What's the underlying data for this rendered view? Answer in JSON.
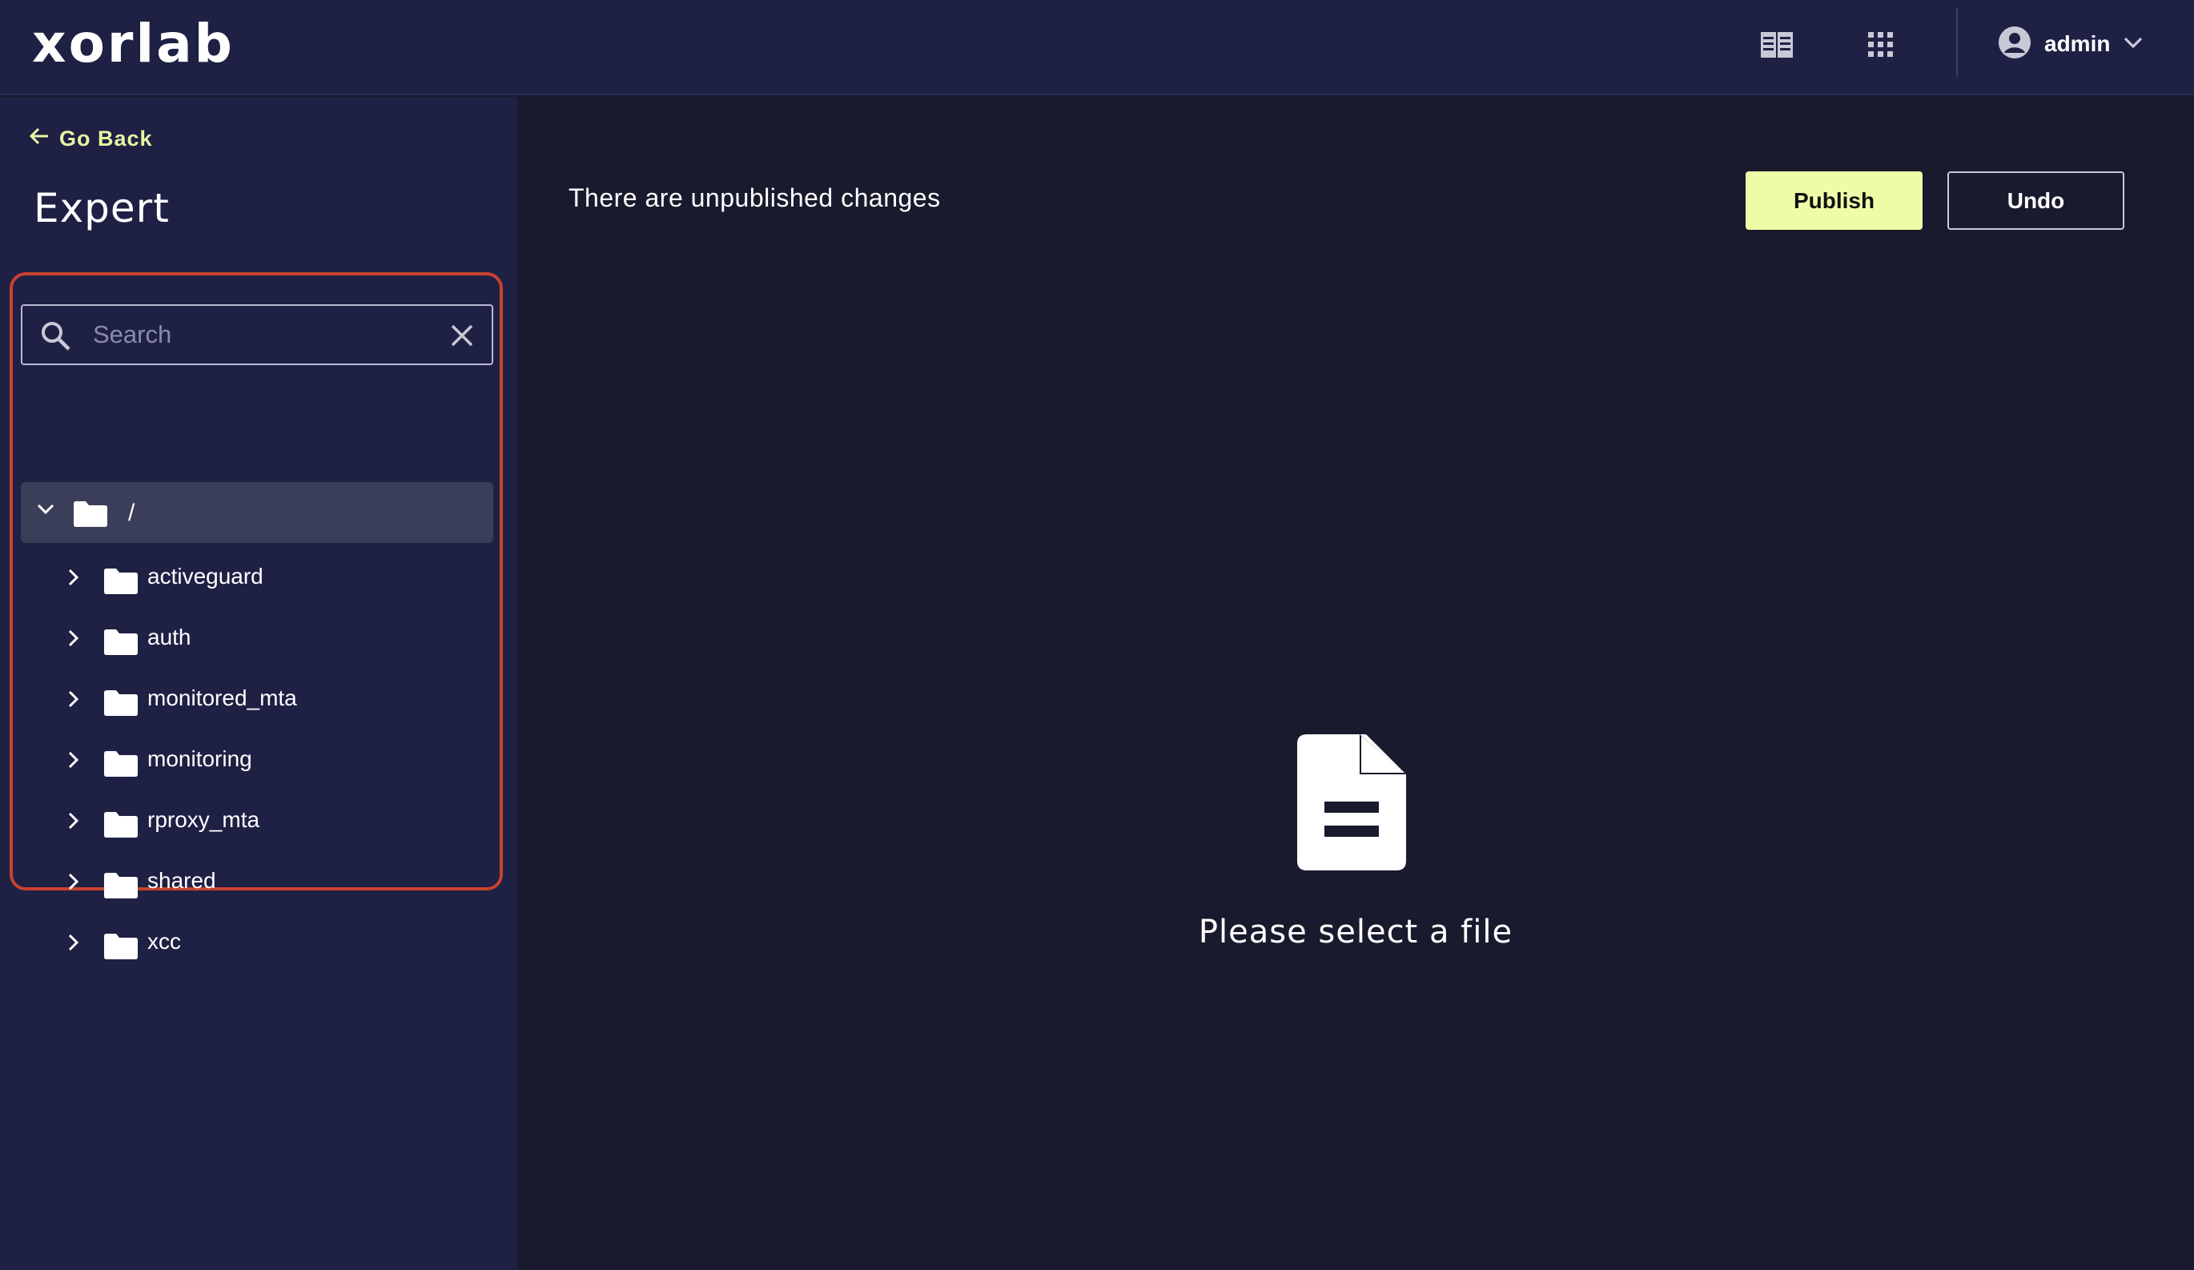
{
  "header": {
    "logo_text": "xorlab",
    "icons": [
      "docs-icon",
      "apps-grid-icon"
    ],
    "user": {
      "name": "admin",
      "icon": "user-circle-icon",
      "menu_icon": "chevron-down-icon"
    }
  },
  "sidebar": {
    "go_back_label": "Go Back",
    "title": "Expert",
    "search": {
      "placeholder": "Search",
      "value": ""
    },
    "tree": {
      "root": {
        "label": "/",
        "expanded": true
      },
      "folders": [
        {
          "label": "activeguard"
        },
        {
          "label": "auth"
        },
        {
          "label": "monitored_mta"
        },
        {
          "label": "monitoring"
        },
        {
          "label": "rproxy_mta"
        },
        {
          "label": "shared"
        },
        {
          "label": "xcc"
        }
      ]
    }
  },
  "main": {
    "changes_message": "There are unpublished changes",
    "publish_label": "Publish",
    "undo_label": "Undo",
    "empty_state": {
      "icon": "document-icon",
      "message": "Please select a file"
    }
  },
  "colors": {
    "header_bg": "#1e2144",
    "sidebar_bg": "#1e2144",
    "main_bg": "#191a2d",
    "accent": "#eefca8",
    "highlight_border": "#c9412f",
    "selected_row": "#3b3e58"
  }
}
